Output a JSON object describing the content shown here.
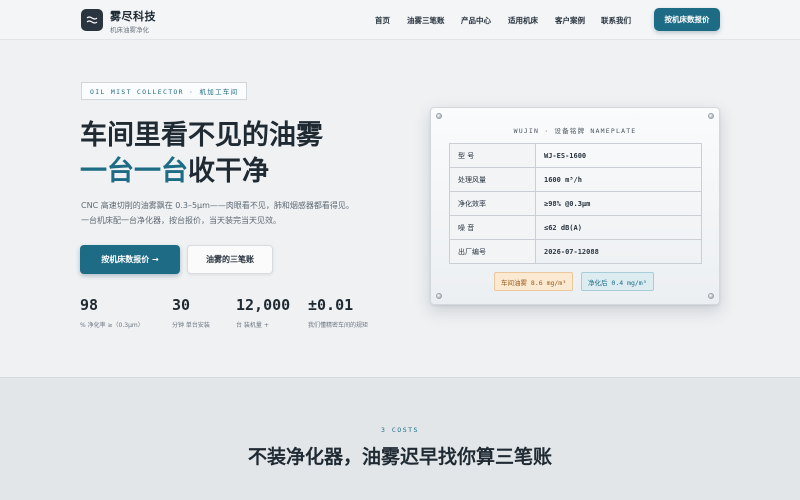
{
  "header": {
    "brand_name": "雾尽科技",
    "brand_sub": "机床油雾净化",
    "logo_icon": "wave-icon",
    "nav": [
      "首页",
      "油雾三笔账",
      "产品中心",
      "适用机床",
      "客户案例",
      "联系我们"
    ],
    "cta": "按机床数报价"
  },
  "hero": {
    "tag": "OIL MIST COLLECTOR · 机加工车间",
    "title_line1": "车间里看不见的油雾",
    "title_line2_accent": "一台一台",
    "title_line2_rest": "收干净",
    "desc": "CNC 高速切削的油雾飘在 0.3–5μm——肉眼看不见，肺和烟感器都看得见。一台机床配一台净化器，按台报价，当天装完当天见效。",
    "btn_primary": "按机床数报价 →",
    "btn_secondary": "油雾的三笔账",
    "stats": [
      {
        "num": "98",
        "label": "% 净化率 ≥（0.3μm）"
      },
      {
        "num": "30",
        "label": "分钟 单台安装"
      },
      {
        "num": "12,000",
        "label": "台 装机量 +"
      },
      {
        "num": "±0.01",
        "label": "我们懂精密车间的规矩"
      }
    ]
  },
  "nameplate": {
    "title": "WUJIN · 设备铭牌 NAMEPLATE",
    "rows": [
      {
        "k": "型 号",
        "v": "WJ-ES-1600"
      },
      {
        "k": "处理风量",
        "v": "1600 m³/h"
      },
      {
        "k": "净化效率",
        "v": "≥98% @0.3μm"
      },
      {
        "k": "噪 音",
        "v": "≤62 dB(A)"
      },
      {
        "k": "出厂编号",
        "v": "2026-07-12088"
      }
    ],
    "badge_before": "车间油雾 8.6 mg/m³",
    "badge_after": "净化后 0.4 mg/m³"
  },
  "section2": {
    "tag": "3 COSTS",
    "title": "不装净化器，油雾迟早找你算三笔账"
  },
  "colors": {
    "accent": "#1d6b85",
    "dark": "#1f2a33",
    "warn_bg": "#fbe9d2",
    "ok_bg": "#dcecf1"
  }
}
